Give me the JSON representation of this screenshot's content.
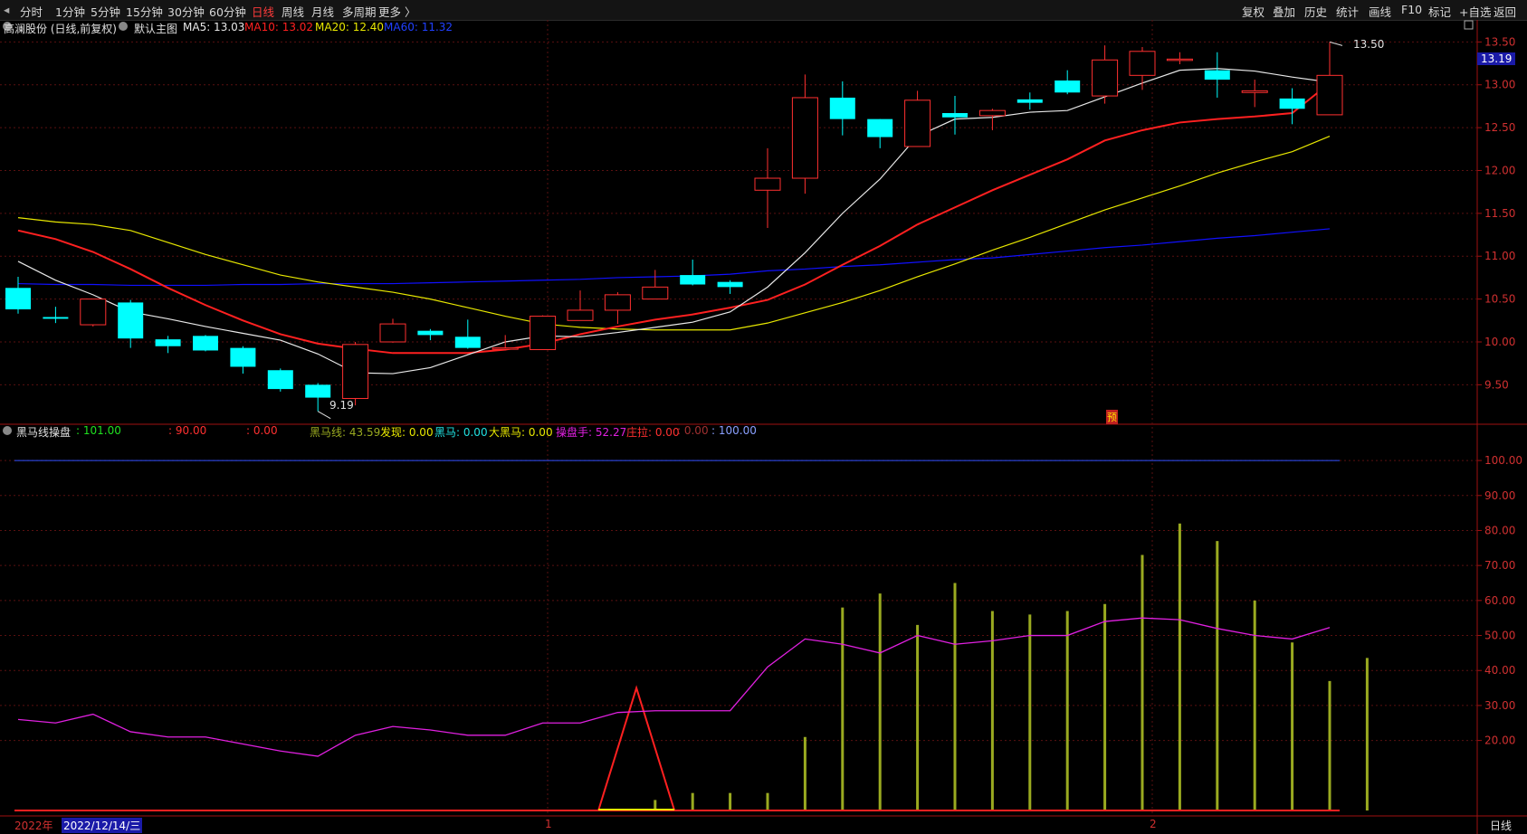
{
  "toolbar": {
    "left_items": [
      "分时",
      "1分钟",
      "5分钟",
      "15分钟",
      "30分钟",
      "60分钟",
      "日线",
      "周线",
      "月线",
      "多周期",
      "更多 〉"
    ],
    "active": "日线",
    "right_items": [
      "复权",
      "叠加",
      "历史",
      "统计",
      "画线",
      "F10",
      "标记",
      "+自选",
      "返回"
    ]
  },
  "main_panel": {
    "stock_label": "高澜股份 (日线,前复权)",
    "indicator_label": "默认主图",
    "ma5": "MA5: 13.03",
    "ma10": "MA10: 13.02",
    "ma20": "MA20: 12.40",
    "ma60": "MA60: 11.32",
    "high_annotation": "13.50",
    "low_annotation": "9.19",
    "current_price": "13.19",
    "forecast_badge": "预"
  },
  "sub_panel": {
    "title": "黑马线操盘",
    "v1": ": 101.00",
    "v2": ": 90.00",
    "v3": ": 0.00",
    "heima_line": "黑马线: 43.59",
    "faxian": "发现: 0.00",
    "heima": "黑马: 0.00",
    "daheima": "大黑马: 0.00",
    "caopanshou": "操盘手: 52.27",
    "zhuangla": "庄拉: 0.00",
    "v4": ": 0.00",
    "v5": ": 100.00"
  },
  "bottom_bar": {
    "year": "2022年",
    "cursor_date": "2022/12/14/三",
    "month1": "1",
    "month2": "2",
    "period": "日线"
  },
  "price_axis": [
    "13.50",
    "13.00",
    "12.50",
    "12.00",
    "11.50",
    "11.00",
    "10.50",
    "10.00",
    "9.50"
  ],
  "sub_axis": [
    "100.00",
    "90.00",
    "80.00",
    "70.00",
    "60.00",
    "50.00",
    "40.00",
    "30.00",
    "20.00"
  ],
  "colors": {
    "up": "#ff3030",
    "down": "#00ffff",
    "ma5": "#e8e8e8",
    "ma10": "#ff2020",
    "ma20": "#e8e800",
    "ma60": "#1010ff",
    "bars": "#9aaa20",
    "caopan": "#e020e0"
  },
  "chart_data": {
    "type": "candlestick",
    "candles": [
      {
        "o": 10.63,
        "h": 10.76,
        "l": 10.33,
        "c": 10.38
      },
      {
        "o": 10.29,
        "h": 10.41,
        "l": 10.22,
        "c": 10.27
      },
      {
        "o": 10.2,
        "h": 10.5,
        "l": 10.18,
        "c": 10.5
      },
      {
        "o": 10.46,
        "h": 10.49,
        "l": 9.93,
        "c": 10.04
      },
      {
        "o": 10.03,
        "h": 10.07,
        "l": 9.87,
        "c": 9.95
      },
      {
        "o": 10.07,
        "h": 10.08,
        "l": 9.89,
        "c": 9.9
      },
      {
        "o": 9.93,
        "h": 9.95,
        "l": 9.63,
        "c": 9.71
      },
      {
        "o": 9.67,
        "h": 9.69,
        "l": 9.42,
        "c": 9.45
      },
      {
        "o": 9.5,
        "h": 9.52,
        "l": 9.19,
        "c": 9.35
      },
      {
        "o": 9.34,
        "h": 10.0,
        "l": 9.26,
        "c": 9.97
      },
      {
        "o": 10.0,
        "h": 10.27,
        "l": 9.99,
        "c": 10.21
      },
      {
        "o": 10.13,
        "h": 10.15,
        "l": 10.02,
        "c": 10.08
      },
      {
        "o": 10.06,
        "h": 10.26,
        "l": 9.92,
        "c": 9.93
      },
      {
        "o": 9.93,
        "h": 10.08,
        "l": 9.9,
        "c": 9.93
      },
      {
        "o": 9.91,
        "h": 10.31,
        "l": 9.91,
        "c": 10.3
      },
      {
        "o": 10.25,
        "h": 10.6,
        "l": 10.25,
        "c": 10.37
      },
      {
        "o": 10.37,
        "h": 10.58,
        "l": 10.21,
        "c": 10.55
      },
      {
        "o": 10.5,
        "h": 10.84,
        "l": 10.5,
        "c": 10.64
      },
      {
        "o": 10.78,
        "h": 10.96,
        "l": 10.66,
        "c": 10.67
      },
      {
        "o": 10.7,
        "h": 10.72,
        "l": 10.56,
        "c": 10.64
      },
      {
        "o": 11.77,
        "h": 12.26,
        "l": 11.33,
        "c": 11.91
      },
      {
        "o": 11.91,
        "h": 13.12,
        "l": 11.73,
        "c": 12.85
      },
      {
        "o": 12.85,
        "h": 13.04,
        "l": 12.41,
        "c": 12.6
      },
      {
        "o": 12.6,
        "h": 12.6,
        "l": 12.26,
        "c": 12.39
      },
      {
        "o": 12.28,
        "h": 12.93,
        "l": 12.28,
        "c": 12.82
      },
      {
        "o": 12.67,
        "h": 12.87,
        "l": 12.42,
        "c": 12.62
      },
      {
        "o": 12.64,
        "h": 12.72,
        "l": 12.47,
        "c": 12.7
      },
      {
        "o": 12.83,
        "h": 12.91,
        "l": 12.71,
        "c": 12.79
      },
      {
        "o": 13.05,
        "h": 13.17,
        "l": 12.89,
        "c": 12.91
      },
      {
        "o": 12.87,
        "h": 13.46,
        "l": 12.78,
        "c": 13.29
      },
      {
        "o": 13.11,
        "h": 13.44,
        "l": 12.94,
        "c": 13.39
      },
      {
        "o": 13.29,
        "h": 13.38,
        "l": 13.24,
        "c": 13.3
      },
      {
        "o": 13.17,
        "h": 13.38,
        "l": 12.85,
        "c": 13.06
      },
      {
        "o": 12.91,
        "h": 13.06,
        "l": 12.74,
        "c": 12.93
      },
      {
        "o": 12.84,
        "h": 12.96,
        "l": 12.54,
        "c": 12.72
      },
      {
        "o": 12.65,
        "h": 13.5,
        "l": 12.65,
        "c": 13.11
      }
    ],
    "ma5": [
      10.94,
      10.72,
      10.55,
      10.35,
      10.27,
      10.18,
      10.1,
      10.02,
      9.86,
      9.64,
      9.63,
      9.7,
      9.85,
      10.0,
      10.07,
      10.06,
      10.11,
      10.17,
      10.23,
      10.35,
      10.64,
      11.04,
      11.5,
      11.9,
      12.4,
      12.6,
      12.62,
      12.68,
      12.7,
      12.86,
      13.02,
      13.17,
      13.19,
      13.16,
      13.09,
      13.03
    ],
    "ma10": [
      11.3,
      11.2,
      11.05,
      10.85,
      10.63,
      10.43,
      10.25,
      10.09,
      9.98,
      9.92,
      9.87,
      9.87,
      9.87,
      9.91,
      9.98,
      10.09,
      10.18,
      10.26,
      10.32,
      10.4,
      10.49,
      10.67,
      10.9,
      11.12,
      11.37,
      11.57,
      11.77,
      11.95,
      12.13,
      12.35,
      12.47,
      12.56,
      12.6,
      12.63,
      12.67,
      13.02
    ],
    "ma20": [
      11.45,
      11.4,
      11.37,
      11.3,
      11.16,
      11.02,
      10.9,
      10.78,
      10.7,
      10.64,
      10.58,
      10.5,
      10.4,
      10.3,
      10.21,
      10.17,
      10.15,
      10.14,
      10.14,
      10.14,
      10.22,
      10.34,
      10.46,
      10.6,
      10.76,
      10.91,
      11.07,
      11.22,
      11.38,
      11.54,
      11.68,
      11.82,
      11.97,
      12.1,
      12.22,
      12.4
    ],
    "ma60": [
      10.68,
      10.67,
      10.67,
      10.66,
      10.66,
      10.66,
      10.67,
      10.67,
      10.68,
      10.68,
      10.68,
      10.69,
      10.7,
      10.71,
      10.72,
      10.73,
      10.75,
      10.76,
      10.77,
      10.79,
      10.83,
      10.85,
      10.88,
      10.9,
      10.93,
      10.96,
      10.98,
      11.02,
      11.06,
      11.1,
      11.13,
      11.17,
      11.21,
      11.24,
      11.28,
      11.32
    ],
    "heima_bars": [
      0,
      0,
      0,
      0,
      0,
      0,
      0,
      0,
      0,
      0,
      0,
      0,
      0,
      0,
      0,
      0,
      0,
      3,
      5,
      5,
      5,
      21,
      58,
      62,
      53,
      65,
      57,
      56,
      57,
      59,
      73,
      82,
      77,
      60,
      48,
      37,
      43.59
    ],
    "caopanshou": [
      26,
      25,
      27.5,
      22.5,
      21,
      21,
      19,
      17,
      15.5,
      21.5,
      24,
      23,
      21.5,
      21.5,
      25,
      25,
      28,
      28.5,
      28.5,
      28.5,
      41,
      49,
      47.5,
      45,
      50,
      47.5,
      48.5,
      50,
      50,
      54,
      55,
      54.5,
      52,
      50,
      49,
      52.27
    ],
    "faxian_peak": {
      "index": 16.5,
      "value": 35
    },
    "price_range": [
      9.05,
      13.62
    ],
    "sub_range": [
      0,
      107
    ]
  }
}
